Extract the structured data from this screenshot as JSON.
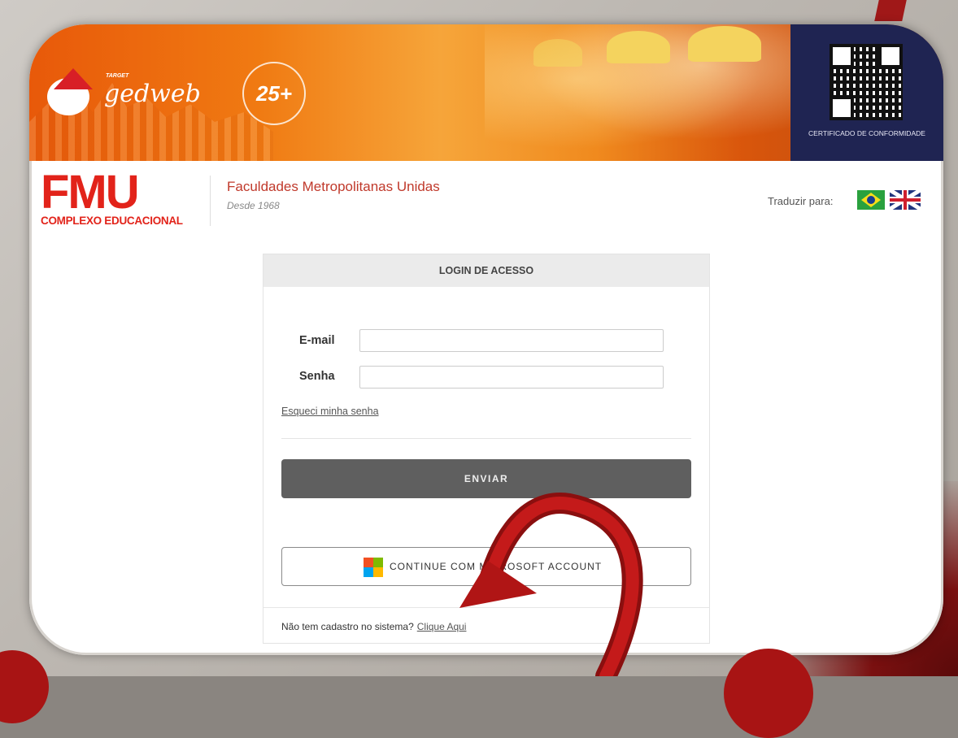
{
  "banner": {
    "brand_small": "TARGET",
    "brand": "gedweb",
    "anniversary_badge": "25+",
    "certificate_label": "CERTIFICADO DE CONFORMIDADE"
  },
  "header": {
    "logo_letters": "FMU",
    "logo_subtitle": "COMPLEXO EDUCACIONAL",
    "org_name": "Faculdades Metropolitanas Unidas",
    "org_since": "Desde 1968",
    "translate_label": "Traduzir para:"
  },
  "login": {
    "title": "LOGIN DE ACESSO",
    "email_label": "E-mail",
    "email_value": "",
    "password_label": "Senha",
    "password_value": "",
    "forgot_link": "Esqueci minha senha",
    "submit_label": "ENVIAR",
    "microsoft_label": "CONTINUE COM MICROSOFT ACCOUNT",
    "no_account_text": "Não tem cadastro no sistema?",
    "register_link": "Clique Aqui"
  },
  "colors": {
    "fmu_red": "#e2231a",
    "banner_orange": "#f07a12",
    "qr_panel": "#1f2452",
    "submit_bg": "#5f5f5f",
    "annotation_red": "#a81414"
  },
  "icons": [
    "santa-hat-icon",
    "qr-code-icon",
    "brazil-flag-icon",
    "uk-flag-icon",
    "microsoft-logo-icon"
  ]
}
